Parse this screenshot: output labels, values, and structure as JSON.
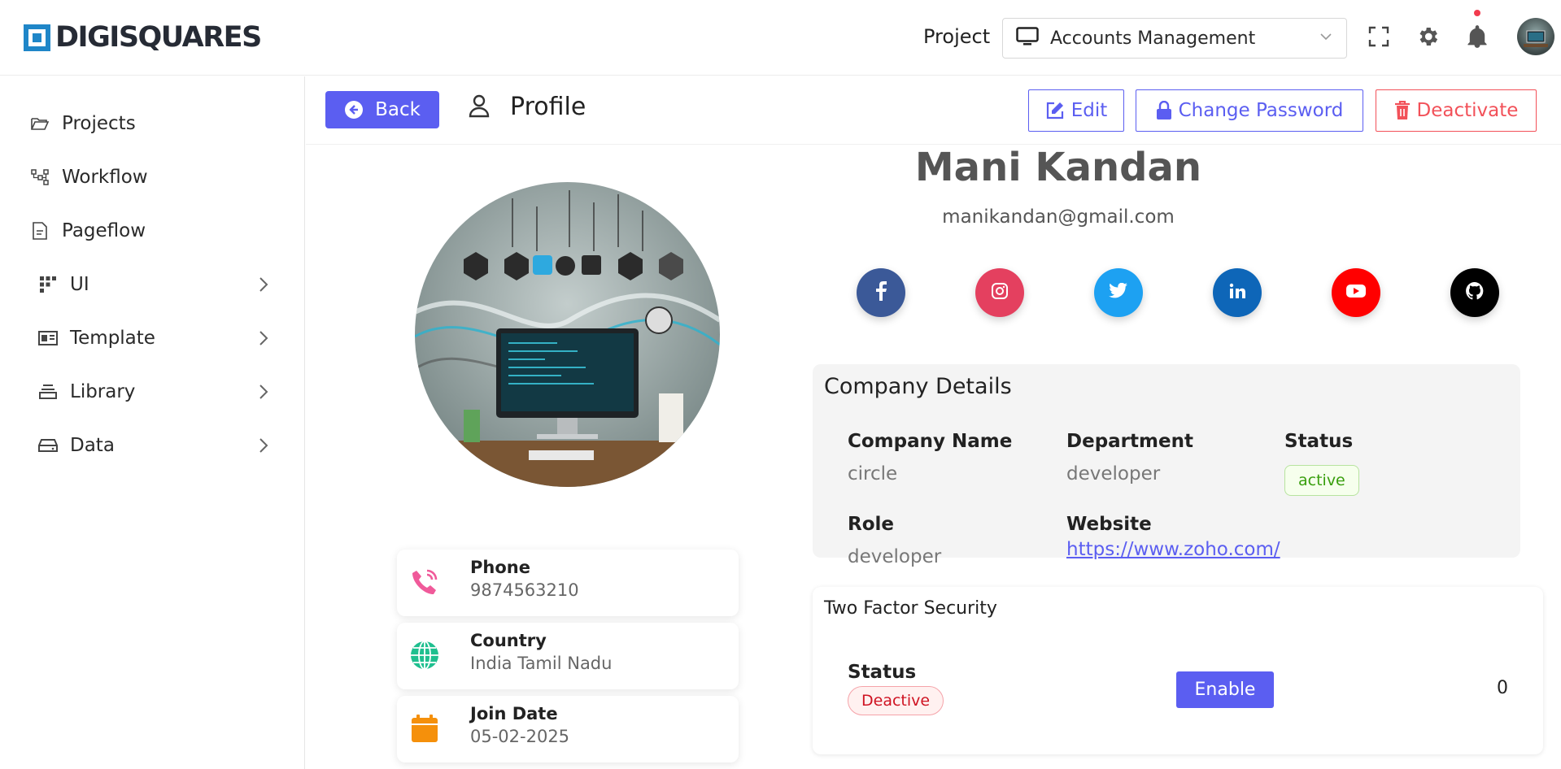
{
  "header": {
    "logo_text": "DIGISQUARES",
    "project_label": "Project",
    "project_value": "Accounts Management",
    "icons": [
      "fullscreen-icon",
      "gear-icon",
      "bell-icon"
    ]
  },
  "sidebar": {
    "items": [
      {
        "label": "Projects",
        "icon": "folder-open-icon",
        "has_arrow": false
      },
      {
        "label": "Workflow",
        "icon": "workflow-icon",
        "has_arrow": false
      },
      {
        "label": "Pageflow",
        "icon": "document-icon",
        "has_arrow": false
      },
      {
        "label": "UI",
        "icon": "grid-icon",
        "has_arrow": true
      },
      {
        "label": "Template",
        "icon": "template-icon",
        "has_arrow": true
      },
      {
        "label": "Library",
        "icon": "stack-icon",
        "has_arrow": true
      },
      {
        "label": "Data",
        "icon": "drive-icon",
        "has_arrow": true
      }
    ]
  },
  "toolbar": {
    "back_label": "Back",
    "title": "Profile",
    "edit_label": "Edit",
    "change_password_label": "Change Password",
    "deactivate_label": "Deactivate"
  },
  "profile": {
    "name": "Mani Kandan",
    "email": "manikandan@gmail.com",
    "phone_label": "Phone",
    "phone": "9874563210",
    "country_label": "Country",
    "country": "India Tamil Nadu",
    "join_label": "Join Date",
    "join_date": "05-02-2025"
  },
  "social": [
    {
      "name": "facebook",
      "color": "#3b5998"
    },
    {
      "name": "instagram",
      "color": "#e4405f"
    },
    {
      "name": "twitter",
      "color": "#1da1f2"
    },
    {
      "name": "linkedin",
      "color": "#0e66b8"
    },
    {
      "name": "youtube",
      "color": "#ff0000"
    },
    {
      "name": "github",
      "color": "#000000"
    }
  ],
  "company": {
    "heading": "Company Details",
    "company_name_label": "Company Name",
    "company_name": "circle",
    "department_label": "Department",
    "department": "developer",
    "status_label": "Status",
    "status": "active",
    "role_label": "Role",
    "role": "developer",
    "website_label": "Website",
    "website": "https://www.zoho.com/"
  },
  "two_factor": {
    "heading": "Two Factor Security",
    "status_label": "Status",
    "status": "Deactive",
    "enable_label": "Enable",
    "count": "0"
  },
  "colors": {
    "primary": "#5b5ef1",
    "danger": "#f25159",
    "brand": "#1f86c8"
  }
}
